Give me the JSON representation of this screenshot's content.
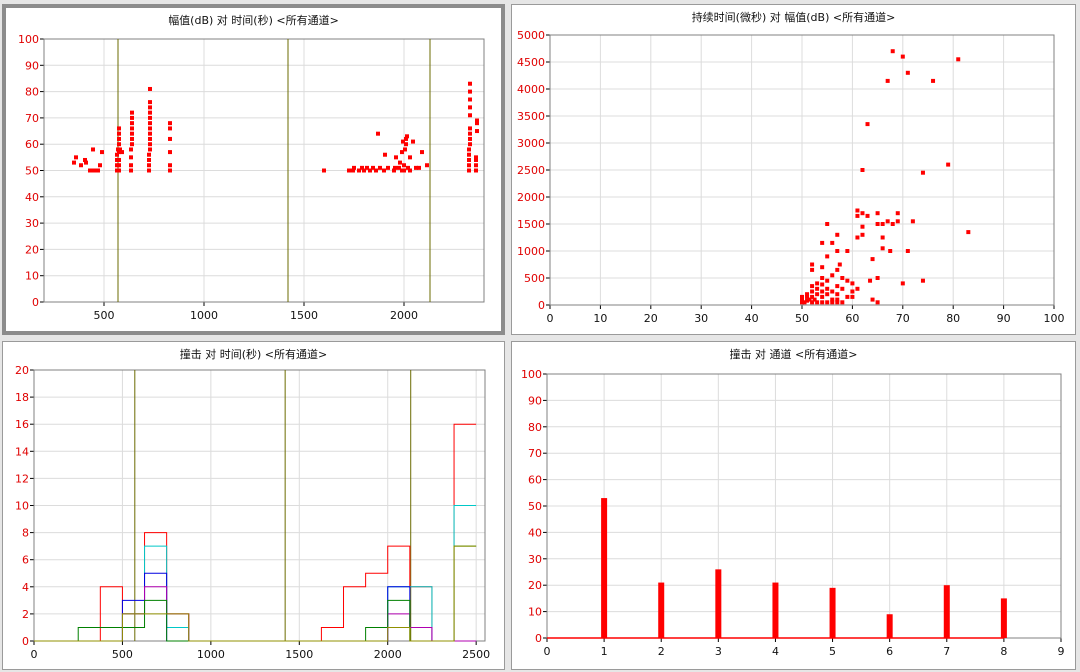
{
  "colors": {
    "data": "#ff0000",
    "grid": "#dcdcdc",
    "marker_line": "#6b6b00"
  },
  "chart_data": [
    {
      "type": "scatter",
      "title": "幅值(dB) 对 时间(秒) <所有通道>",
      "xlim": [
        200,
        2400
      ],
      "ylim": [
        0,
        100
      ],
      "xticks": [
        500,
        1000,
        1500,
        2000
      ],
      "yticks": [
        0,
        10,
        20,
        30,
        40,
        50,
        60,
        70,
        80,
        90,
        100
      ],
      "grid": true,
      "vlines": [
        570,
        1420,
        2130
      ],
      "points": [
        [
          350,
          53
        ],
        [
          360,
          55
        ],
        [
          385,
          52
        ],
        [
          405,
          54
        ],
        [
          410,
          53
        ],
        [
          430,
          50
        ],
        [
          445,
          58
        ],
        [
          450,
          50
        ],
        [
          470,
          50
        ],
        [
          480,
          52
        ],
        [
          490,
          57
        ],
        [
          565,
          50
        ],
        [
          565,
          52
        ],
        [
          565,
          54
        ],
        [
          565,
          56
        ],
        [
          570,
          58
        ],
        [
          575,
          50
        ],
        [
          575,
          52
        ],
        [
          575,
          54
        ],
        [
          575,
          57
        ],
        [
          575,
          60
        ],
        [
          575,
          62
        ],
        [
          575,
          64
        ],
        [
          575,
          66
        ],
        [
          580,
          58
        ],
        [
          590,
          57
        ],
        [
          635,
          50
        ],
        [
          635,
          52
        ],
        [
          635,
          55
        ],
        [
          635,
          58
        ],
        [
          640,
          60
        ],
        [
          640,
          62
        ],
        [
          640,
          64
        ],
        [
          640,
          66
        ],
        [
          640,
          68
        ],
        [
          640,
          70
        ],
        [
          640,
          72
        ],
        [
          725,
          50
        ],
        [
          725,
          52
        ],
        [
          725,
          54
        ],
        [
          725,
          56
        ],
        [
          730,
          58
        ],
        [
          730,
          60
        ],
        [
          730,
          62
        ],
        [
          730,
          64
        ],
        [
          730,
          66
        ],
        [
          730,
          68
        ],
        [
          730,
          70
        ],
        [
          730,
          72
        ],
        [
          730,
          74
        ],
        [
          730,
          76
        ],
        [
          730,
          81
        ],
        [
          830,
          50
        ],
        [
          830,
          52
        ],
        [
          830,
          57
        ],
        [
          830,
          62
        ],
        [
          830,
          66
        ],
        [
          830,
          68
        ],
        [
          1600,
          50
        ],
        [
          1725,
          50
        ],
        [
          1745,
          50
        ],
        [
          1750,
          51
        ],
        [
          1775,
          50
        ],
        [
          1790,
          51
        ],
        [
          1800,
          50
        ],
        [
          1815,
          51
        ],
        [
          1830,
          50
        ],
        [
          1845,
          51
        ],
        [
          1860,
          50
        ],
        [
          1870,
          64
        ],
        [
          1880,
          51
        ],
        [
          1900,
          50
        ],
        [
          1905,
          56
        ],
        [
          1920,
          51
        ],
        [
          1950,
          50
        ],
        [
          1955,
          51
        ],
        [
          1960,
          55
        ],
        [
          1975,
          51
        ],
        [
          1980,
          53
        ],
        [
          1990,
          50
        ],
        [
          1990,
          57
        ],
        [
          1995,
          61
        ],
        [
          2000,
          50
        ],
        [
          2000,
          52
        ],
        [
          2005,
          58
        ],
        [
          2010,
          60
        ],
        [
          2010,
          62
        ],
        [
          2015,
          63
        ],
        [
          2020,
          51
        ],
        [
          2030,
          50
        ],
        [
          2030,
          55
        ],
        [
          2045,
          61
        ],
        [
          2060,
          51
        ],
        [
          2075,
          51
        ],
        [
          2090,
          57
        ],
        [
          2115,
          52
        ],
        [
          2325,
          50
        ],
        [
          2325,
          52
        ],
        [
          2325,
          54
        ],
        [
          2325,
          56
        ],
        [
          2325,
          58
        ],
        [
          2330,
          60
        ],
        [
          2330,
          62
        ],
        [
          2330,
          64
        ],
        [
          2330,
          66
        ],
        [
          2330,
          71
        ],
        [
          2330,
          74
        ],
        [
          2330,
          77
        ],
        [
          2330,
          80
        ],
        [
          2330,
          83
        ],
        [
          2360,
          50
        ],
        [
          2360,
          52
        ],
        [
          2360,
          54
        ],
        [
          2360,
          55
        ],
        [
          2365,
          65
        ],
        [
          2365,
          68
        ],
        [
          2365,
          69
        ]
      ]
    },
    {
      "type": "scatter",
      "title": "持续时间(微秒) 对 幅值(dB) <所有通道>",
      "xlim": [
        0,
        100
      ],
      "ylim": [
        0,
        5000
      ],
      "xticks": [
        0,
        10,
        20,
        30,
        40,
        50,
        60,
        70,
        80,
        90,
        100
      ],
      "yticks": [
        0,
        500,
        1000,
        1500,
        2000,
        2500,
        3000,
        3500,
        4000,
        4500,
        5000
      ],
      "grid": true,
      "points": [
        [
          50,
          50
        ],
        [
          50,
          100
        ],
        [
          50,
          150
        ],
        [
          50.5,
          50
        ],
        [
          51,
          80
        ],
        [
          51,
          150
        ],
        [
          51,
          200
        ],
        [
          51.5,
          100
        ],
        [
          52,
          50
        ],
        [
          52,
          150
        ],
        [
          52,
          250
        ],
        [
          52,
          350
        ],
        [
          52,
          650
        ],
        [
          52,
          750
        ],
        [
          52.5,
          100
        ],
        [
          53,
          50
        ],
        [
          53,
          200
        ],
        [
          53,
          300
        ],
        [
          53,
          400
        ],
        [
          54,
          50
        ],
        [
          54,
          150
        ],
        [
          54,
          250
        ],
        [
          54,
          380
        ],
        [
          54,
          500
        ],
        [
          54,
          700
        ],
        [
          54,
          1150
        ],
        [
          55,
          50
        ],
        [
          55,
          200
        ],
        [
          55,
          300
        ],
        [
          55,
          450
        ],
        [
          55,
          900
        ],
        [
          55,
          1500
        ],
        [
          56,
          50
        ],
        [
          56,
          100
        ],
        [
          56,
          250
        ],
        [
          56,
          550
        ],
        [
          56,
          1150
        ],
        [
          57,
          50
        ],
        [
          57,
          100
        ],
        [
          57,
          200
        ],
        [
          57,
          350
        ],
        [
          57,
          650
        ],
        [
          57,
          1000
        ],
        [
          57,
          1300
        ],
        [
          57.5,
          750
        ],
        [
          58,
          50
        ],
        [
          58,
          300
        ],
        [
          58,
          500
        ],
        [
          59,
          150
        ],
        [
          59,
          450
        ],
        [
          59,
          1000
        ],
        [
          60,
          150
        ],
        [
          60,
          250
        ],
        [
          60,
          400
        ],
        [
          61,
          300
        ],
        [
          61,
          1250
        ],
        [
          61,
          1650
        ],
        [
          61,
          1750
        ],
        [
          62,
          1300
        ],
        [
          62,
          1450
        ],
        [
          62,
          1700
        ],
        [
          62,
          2500
        ],
        [
          63,
          1650
        ],
        [
          63,
          3350
        ],
        [
          63.5,
          450
        ],
        [
          64,
          100
        ],
        [
          64,
          850
        ],
        [
          65,
          50
        ],
        [
          65,
          500
        ],
        [
          65,
          1500
        ],
        [
          65,
          1700
        ],
        [
          66,
          1050
        ],
        [
          66,
          1250
        ],
        [
          66,
          1500
        ],
        [
          67,
          1550
        ],
        [
          67,
          4150
        ],
        [
          67.5,
          1000
        ],
        [
          68,
          1500
        ],
        [
          68,
          4700
        ],
        [
          69,
          1550
        ],
        [
          69,
          1700
        ],
        [
          70,
          400
        ],
        [
          70,
          4600
        ],
        [
          71,
          1000
        ],
        [
          71,
          4300
        ],
        [
          72,
          1550
        ],
        [
          74,
          450
        ],
        [
          74,
          2450
        ],
        [
          76,
          4150
        ],
        [
          79,
          2600
        ],
        [
          81,
          4550
        ],
        [
          83,
          1350
        ]
      ]
    },
    {
      "type": "histogram",
      "title": "撞击 对 时间(秒) <所有通道>",
      "xlim": [
        0,
        2550
      ],
      "ylim": [
        0,
        20
      ],
      "xticks": [
        0,
        500,
        1000,
        1500,
        2000,
        2500
      ],
      "yticks": [
        0,
        2,
        4,
        6,
        8,
        10,
        12,
        14,
        16,
        18,
        20
      ],
      "grid": true,
      "vlines": [
        570,
        1420,
        2130
      ],
      "bin_edges": [
        0,
        125,
        250,
        375,
        500,
        625,
        750,
        875,
        1000,
        1125,
        1250,
        1375,
        1500,
        1625,
        1750,
        1875,
        2000,
        2125,
        2250,
        2375,
        2500
      ],
      "series": [
        {
          "color": "#ff0000",
          "values": [
            0,
            0,
            0,
            4,
            2,
            8,
            2,
            0,
            0,
            0,
            0,
            0,
            0,
            1,
            4,
            5,
            7,
            4,
            0,
            16
          ]
        },
        {
          "color": "#00c8c8",
          "values": [
            0,
            0,
            0,
            0,
            2,
            7,
            1,
            0,
            0,
            0,
            0,
            0,
            0,
            0,
            0,
            0,
            4,
            4,
            0,
            10
          ]
        },
        {
          "color": "#0000e0",
          "values": [
            0,
            0,
            0,
            0,
            3,
            5,
            0,
            0,
            0,
            0,
            0,
            0,
            0,
            0,
            0,
            0,
            4,
            1,
            0,
            0
          ]
        },
        {
          "color": "#b000b0",
          "values": [
            0,
            0,
            0,
            0,
            2,
            4,
            2,
            0,
            0,
            0,
            0,
            0,
            0,
            0,
            0,
            0,
            2,
            1,
            0,
            0
          ]
        },
        {
          "color": "#008000",
          "values": [
            0,
            0,
            1,
            1,
            1,
            3,
            0,
            0,
            0,
            0,
            0,
            0,
            0,
            0,
            0,
            1,
            3,
            0,
            0,
            7
          ]
        },
        {
          "color": "#909000",
          "values": [
            0,
            0,
            0,
            0,
            2,
            2,
            2,
            0,
            0,
            0,
            0,
            0,
            0,
            0,
            0,
            0,
            1,
            0,
            0,
            7
          ]
        }
      ]
    },
    {
      "type": "bar",
      "title": "撞击 对 通道 <所有通道>",
      "xlim": [
        0,
        9
      ],
      "ylim": [
        0,
        100
      ],
      "xticks": [
        0,
        1,
        2,
        3,
        4,
        5,
        6,
        7,
        8,
        9
      ],
      "yticks": [
        0,
        10,
        20,
        30,
        40,
        50,
        60,
        70,
        80,
        90,
        100
      ],
      "grid": true,
      "categories": [
        1,
        2,
        3,
        4,
        5,
        6,
        7,
        8
      ],
      "values": [
        53,
        21,
        26,
        21,
        19,
        9,
        20,
        15
      ]
    }
  ]
}
